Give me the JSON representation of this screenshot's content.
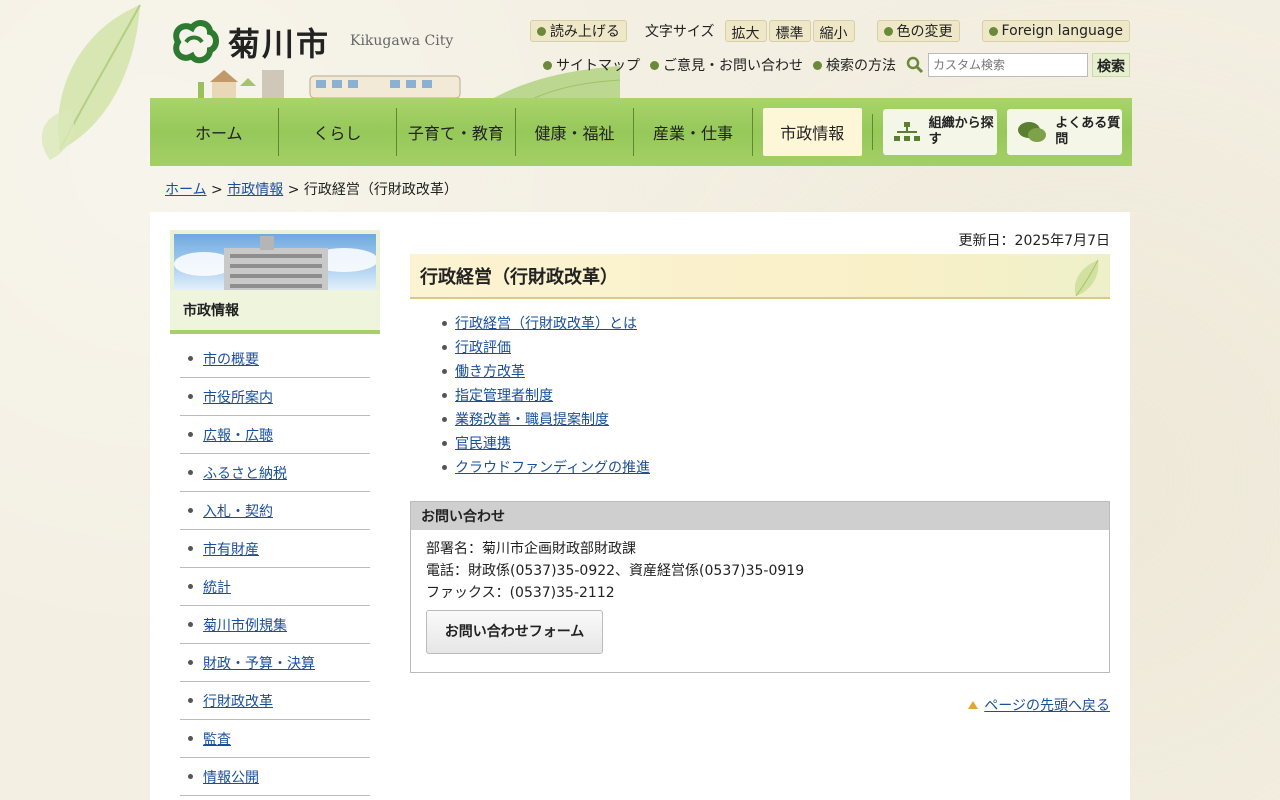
{
  "header": {
    "logo_text": "菊川市",
    "logo_en": "Kikugawa City",
    "read_aloud": "読み上げる",
    "font_size_label": "文字サイズ",
    "font_sizes": [
      "拡大",
      "標準",
      "縮小"
    ],
    "color_change": "色の変更",
    "foreign_language": "Foreign language",
    "sitemap": "サイトマップ",
    "feedback": "ご意見・お問い合わせ",
    "search_method": "検索の方法",
    "search_placeholder": "カスタム検索",
    "search_button": "検索"
  },
  "nav": {
    "items": [
      "ホーム",
      "くらし",
      "子育て・教育",
      "健康・福祉",
      "産業・仕事",
      "市政情報"
    ],
    "active_index": 5,
    "org_search": "組織から探す",
    "faq": "よくある質問"
  },
  "breadcrumb": {
    "home": "ホーム",
    "sep1": ">",
    "parent": "市政情報",
    "sep2": ">",
    "current": "行政経営（行財政改革）"
  },
  "sidebar": {
    "title": "市政情報",
    "items": [
      "市の概要",
      "市役所案内",
      "広報・広聴",
      "ふるさと納税",
      "入札・契約",
      "市有財産",
      "統計",
      "菊川市例規集",
      "財政・予算・決算",
      "行財政改革",
      "監査",
      "情報公開"
    ]
  },
  "content": {
    "updated": "更新日：2025年7月7日",
    "title": "行政経営（行財政改革）",
    "links": [
      "行政経営（行財政改革）とは",
      "行政評価",
      "働き方改革",
      "指定管理者制度",
      "業務改善・職員提案制度",
      "官民連携",
      "クラウドファンディングの推進"
    ]
  },
  "contact": {
    "heading": "お問い合わせ",
    "department": "部署名：菊川市企画財政部財政課",
    "phone": "電話：財政係(0537)35-0922、資産経営係(0537)35-0919",
    "fax": "ファックス：(0537)35-2112",
    "form_button": "お問い合わせフォーム"
  },
  "page_top": "ページの先頭へ戻る",
  "colors": {
    "nav_green": "#96c85a",
    "link_blue": "#1a4f9c",
    "title_bg": "#fcf3d2"
  }
}
